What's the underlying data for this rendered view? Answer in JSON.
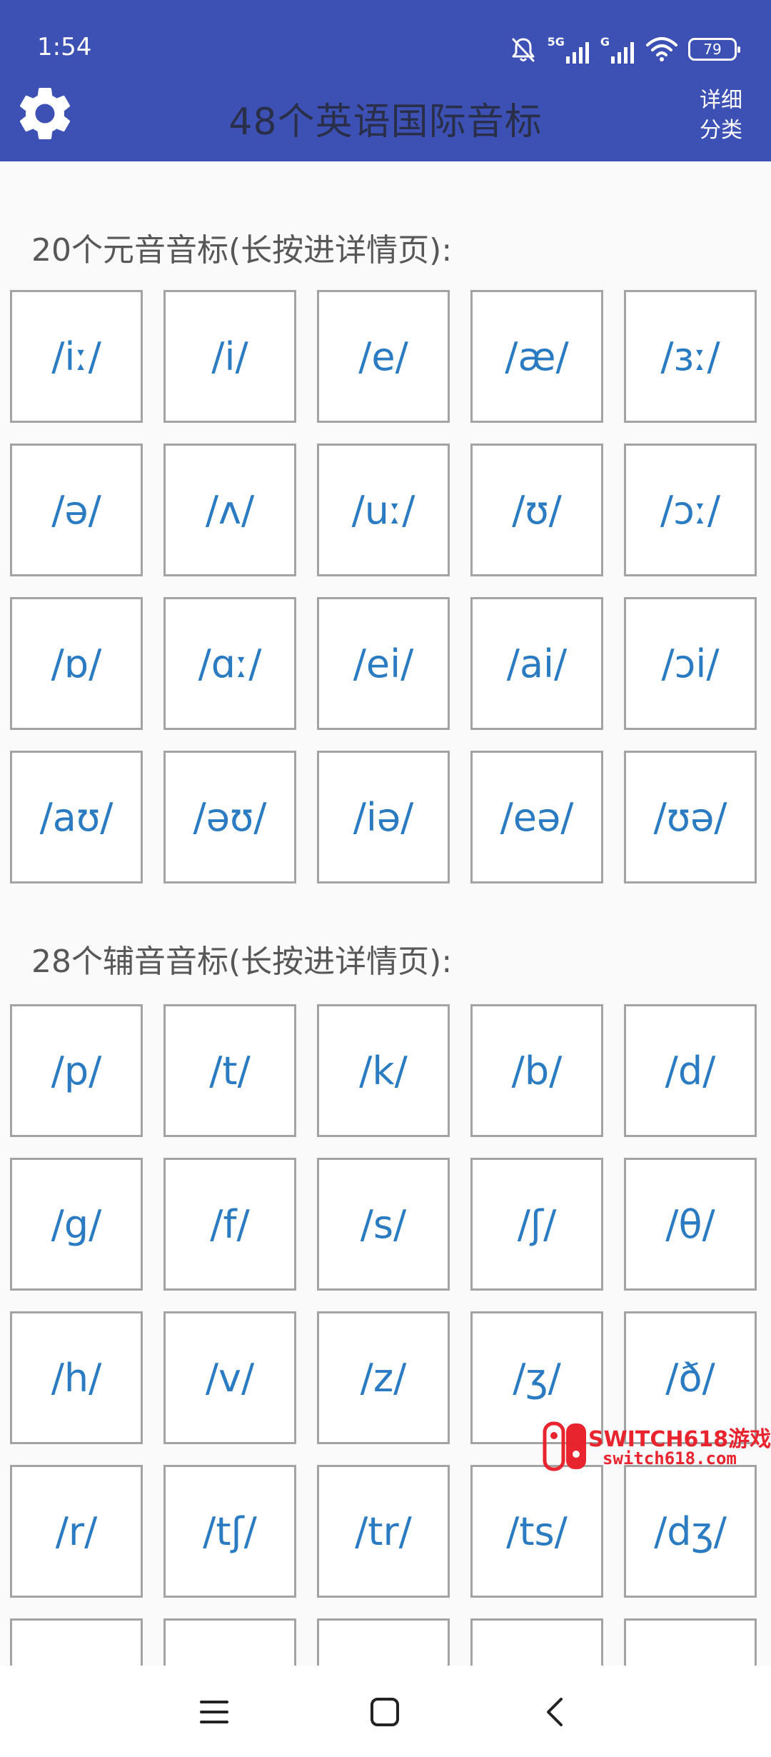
{
  "status_bar": {
    "time": "1:54",
    "network_label": "5G",
    "network_label_2": "G",
    "battery": "79"
  },
  "toolbar": {
    "title": "48个英语国际音标",
    "detail_line1": "详细",
    "detail_line2": "分类"
  },
  "vowels": {
    "title": "20个元音音标(长按进详情页):",
    "items": [
      "/iː/",
      "/i/",
      "/e/",
      "/æ/",
      "/ɜː/",
      "/ə/",
      "/ʌ/",
      "/uː/",
      "/ʊ/",
      "/ɔː/",
      "/ɒ/",
      "/ɑː/",
      "/ei/",
      "/ai/",
      "/ɔi/",
      "/aʊ/",
      "/əʊ/",
      "/iə/",
      "/eə/",
      "/ʊə/"
    ]
  },
  "consonants": {
    "title": "28个辅音音标(长按进详情页):",
    "items": [
      "/p/",
      "/t/",
      "/k/",
      "/b/",
      "/d/",
      "/g/",
      "/f/",
      "/s/",
      "/ʃ/",
      "/θ/",
      "/h/",
      "/v/",
      "/z/",
      "/ʒ/",
      "/ð/",
      "/r/",
      "/tʃ/",
      "/tr/",
      "/ts/",
      "/dʒ/",
      "",
      "",
      "",
      "",
      ""
    ]
  },
  "watermark": {
    "line1": "SWITCH618游戏",
    "line2": "switch618.com"
  },
  "colors": {
    "header": "#3d51b5",
    "phonetic_text": "#2a7bc1",
    "cell_border": "#a3a3a3",
    "watermark": "#e8242f"
  },
  "icons": {
    "settings": "gear-icon",
    "mute": "bell-off-icon",
    "wifi": "wifi-icon",
    "nav_menu": "menu-icon",
    "nav_home": "home-square-icon",
    "nav_back": "back-chevron-icon"
  }
}
